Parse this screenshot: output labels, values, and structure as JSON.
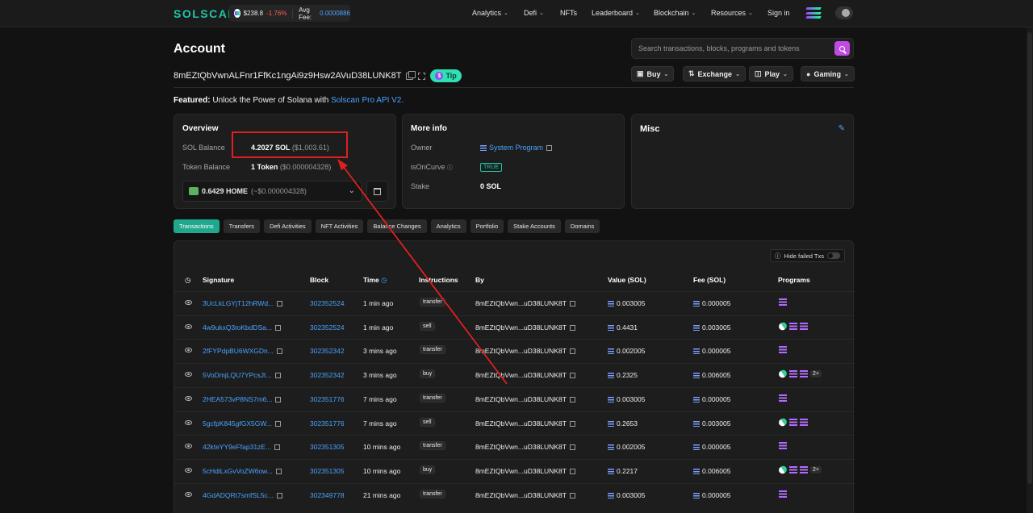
{
  "topbar": {
    "logo": "SOLSCAN",
    "sol_price": "$238.8",
    "sol_change": "-1.76%",
    "avg_fee_label": "Avg Fee:",
    "avg_fee_value": "0.0000886",
    "nav": [
      "Analytics",
      "Defi",
      "NFTs",
      "Leaderboard",
      "Blockchain",
      "Resources",
      "Sign in"
    ]
  },
  "header": {
    "title": "Account",
    "address": "8mEZtQbVwnALFnr1FfKc1ngAi9z9Hsw2AVuD38LUNK8T",
    "tip_label": "Tip",
    "search_placeholder": "Search transactions, blocks, programs and tokens",
    "buttons": [
      "Buy",
      "Exchange",
      "Play",
      "Gaming"
    ]
  },
  "featured": {
    "label": "Featured:",
    "text": "Unlock the Power of Solana with",
    "link": "Solscan Pro API V2."
  },
  "overview": {
    "title": "Overview",
    "sol_balance_label": "SOL Balance",
    "sol_balance": "4.2027 SOL",
    "sol_balance_usd": "($1,003.61)",
    "token_balance_label": "Token Balance",
    "token_balance": "1 Token",
    "token_balance_usd": "($0.000004328)",
    "token_select": "0.6429 HOME",
    "token_select_usd": "(~$0.000004328)"
  },
  "more_info": {
    "title": "More info",
    "owner_label": "Owner",
    "owner_value": "System Program",
    "curve_label": "isOnCurve",
    "curve_value": "TRUE",
    "stake_label": "Stake",
    "stake_value": "0 SOL"
  },
  "misc": {
    "title": "Misc"
  },
  "tabs": [
    "Transactions",
    "Transfers",
    "Defi Activities",
    "NFT Activities",
    "Balance Changes",
    "Analytics",
    "Portfolio",
    "Stake Accounts",
    "Domains"
  ],
  "table": {
    "hide_failed_label": "Hide failed Txs",
    "headers": [
      "Signature",
      "Block",
      "Time",
      "Instructions",
      "By",
      "Value (SOL)",
      "Fee (SOL)",
      "Programs"
    ],
    "rows": [
      {
        "sig": "3UcLkLGYjT12hRWd...",
        "block": "302352524",
        "time": "1 min ago",
        "instr": "transfer",
        "by": "8mEZtQbVwn...uD38LUNK8T",
        "value": "0.003005",
        "fee": "0.000005",
        "programs": "solana",
        "more": ""
      },
      {
        "sig": "4w9ukxQ3toKbdDSa...",
        "block": "302352524",
        "time": "1 min ago",
        "instr": "sell",
        "by": "8mEZtQbVwn...uD38LUNK8T",
        "value": "0.4431",
        "fee": "0.003005",
        "programs": "pill+solana",
        "more": ""
      },
      {
        "sig": "2fFYPdpBU6WXGDn...",
        "block": "302352342",
        "time": "3 mins ago",
        "instr": "transfer",
        "by": "8mEZtQbVwn...uD38LUNK8T",
        "value": "0.002005",
        "fee": "0.000005",
        "programs": "solana",
        "more": ""
      },
      {
        "sig": "5VoDmjLQU7YPcsJt...",
        "block": "302352342",
        "time": "3 mins ago",
        "instr": "buy",
        "by": "8mEZtQbVwn...uD38LUNK8T",
        "value": "0.2325",
        "fee": "0.006005",
        "programs": "pill+solana",
        "more": "2+"
      },
      {
        "sig": "2HEA573vP8NS7m6...",
        "block": "302351776",
        "time": "7 mins ago",
        "instr": "transfer",
        "by": "8mEZtQbVwn...uD38LUNK8T",
        "value": "0.003005",
        "fee": "0.000005",
        "programs": "solana",
        "more": ""
      },
      {
        "sig": "5gcfpK845gfGX5GW...",
        "block": "302351776",
        "time": "7 mins ago",
        "instr": "sell",
        "by": "8mEZtQbVwn...uD38LUNK8T",
        "value": "0.2653",
        "fee": "0.003005",
        "programs": "pill+solana",
        "more": ""
      },
      {
        "sig": "42kteYY9eFfap31zE...",
        "block": "302351305",
        "time": "10 mins ago",
        "instr": "transfer",
        "by": "8mEZtQbVwn...uD38LUNK8T",
        "value": "0.002005",
        "fee": "0.000005",
        "programs": "solana",
        "more": ""
      },
      {
        "sig": "5cHdiLxGvVoZW6ow...",
        "block": "302351305",
        "time": "10 mins ago",
        "instr": "buy",
        "by": "8mEZtQbVwn...uD38LUNK8T",
        "value": "0.2217",
        "fee": "0.006005",
        "programs": "pill+solana",
        "more": "2+"
      },
      {
        "sig": "4GdADQRt7smfSL5c...",
        "block": "302349778",
        "time": "21 mins ago",
        "instr": "transfer",
        "by": "8mEZtQbVwn...uD38LUNK8T",
        "value": "0.003005",
        "fee": "0.000005",
        "programs": "solana",
        "more": ""
      }
    ]
  },
  "colors": {
    "accent": "#1fc7a8",
    "link": "#4aa3ff",
    "annotation": "#e02020",
    "search_button": "#c04be3"
  }
}
